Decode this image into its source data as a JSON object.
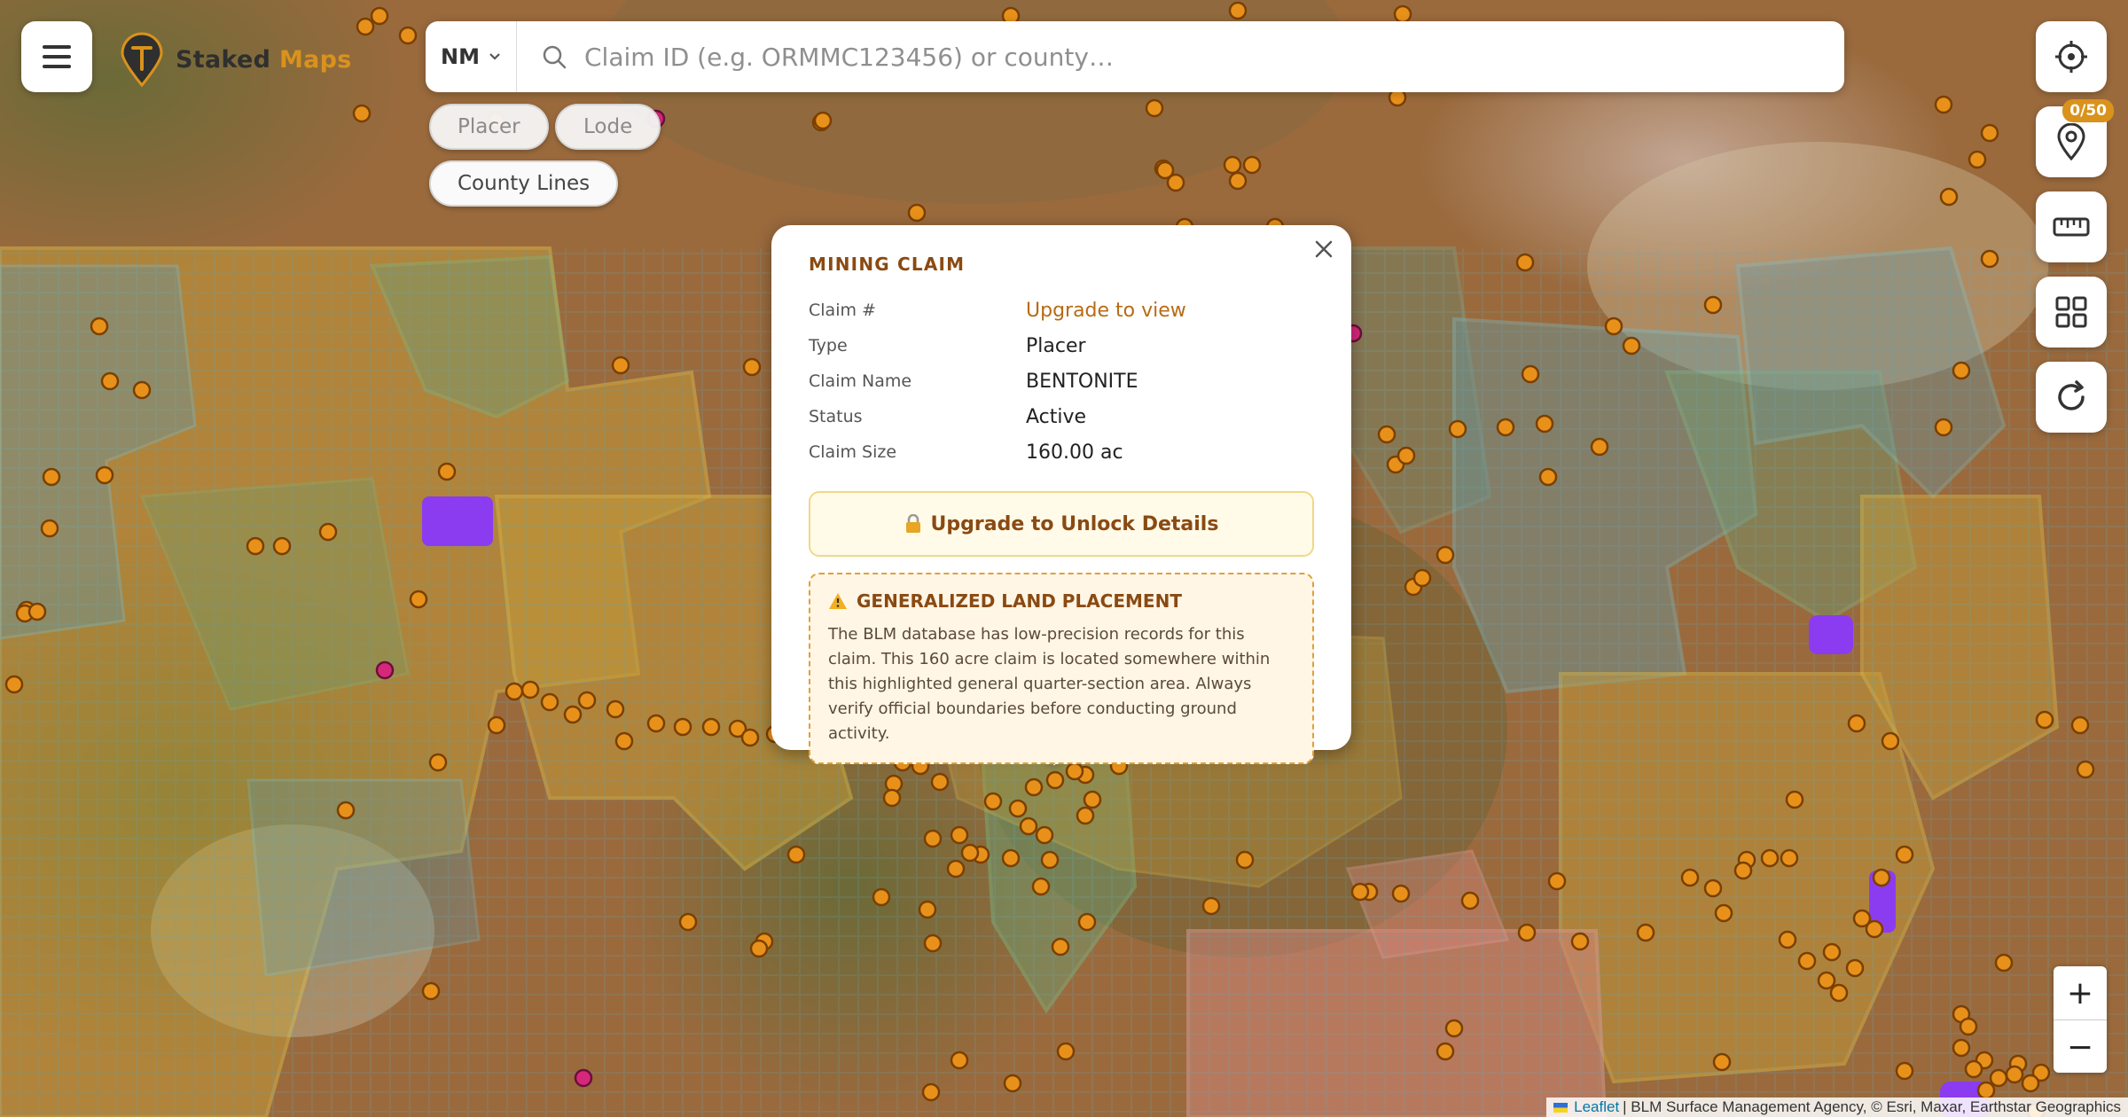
{
  "app": {
    "brand_part1": "Staked",
    "brand_part2": "Maps",
    "brand_color": "#d9921c"
  },
  "search": {
    "state": "NM",
    "placeholder": "Claim ID (e.g. ORMMC123456) or county…"
  },
  "filters": [
    {
      "label": "Placer",
      "active": false
    },
    {
      "label": "Lode",
      "active": false
    },
    {
      "label": "County Lines",
      "active": true
    }
  ],
  "tools": [
    {
      "name": "locate-icon"
    },
    {
      "name": "saved-pins-icon",
      "badge": "0/50"
    },
    {
      "name": "ruler-icon"
    },
    {
      "name": "layers-grid-icon"
    },
    {
      "name": "refresh-icon"
    }
  ],
  "zoom": {
    "in": "+",
    "out": "−"
  },
  "attribution": {
    "leaflet": "Leaflet",
    "text": "| BLM Surface Management Agency, © Esri, Maxar, Earthstar Geographics"
  },
  "popup": {
    "title": "MINING CLAIM",
    "rows": [
      {
        "label": "Claim #",
        "value": "Upgrade to view",
        "locked": true
      },
      {
        "label": "Type",
        "value": "Placer"
      },
      {
        "label": "Claim Name",
        "value": "BENTONITE"
      },
      {
        "label": "Status",
        "value": "Active"
      },
      {
        "label": "Claim Size",
        "value": "160.00 ac"
      }
    ],
    "unlock_button": "Upgrade to Unlock Details",
    "warning_title": "GENERALIZED LAND PLACEMENT",
    "warning_body": "The BLM database has low-precision records for this claim. This 160 acre claim is located somewhere within this highlighted general quarter-section area. Always verify official boundaries before conducting ground activity."
  },
  "colors": {
    "claim_marker": "#e8911a",
    "claim_marker_stroke": "#7a3f00",
    "active_claim": "#8b3cf0",
    "accent": "#b86a14"
  }
}
